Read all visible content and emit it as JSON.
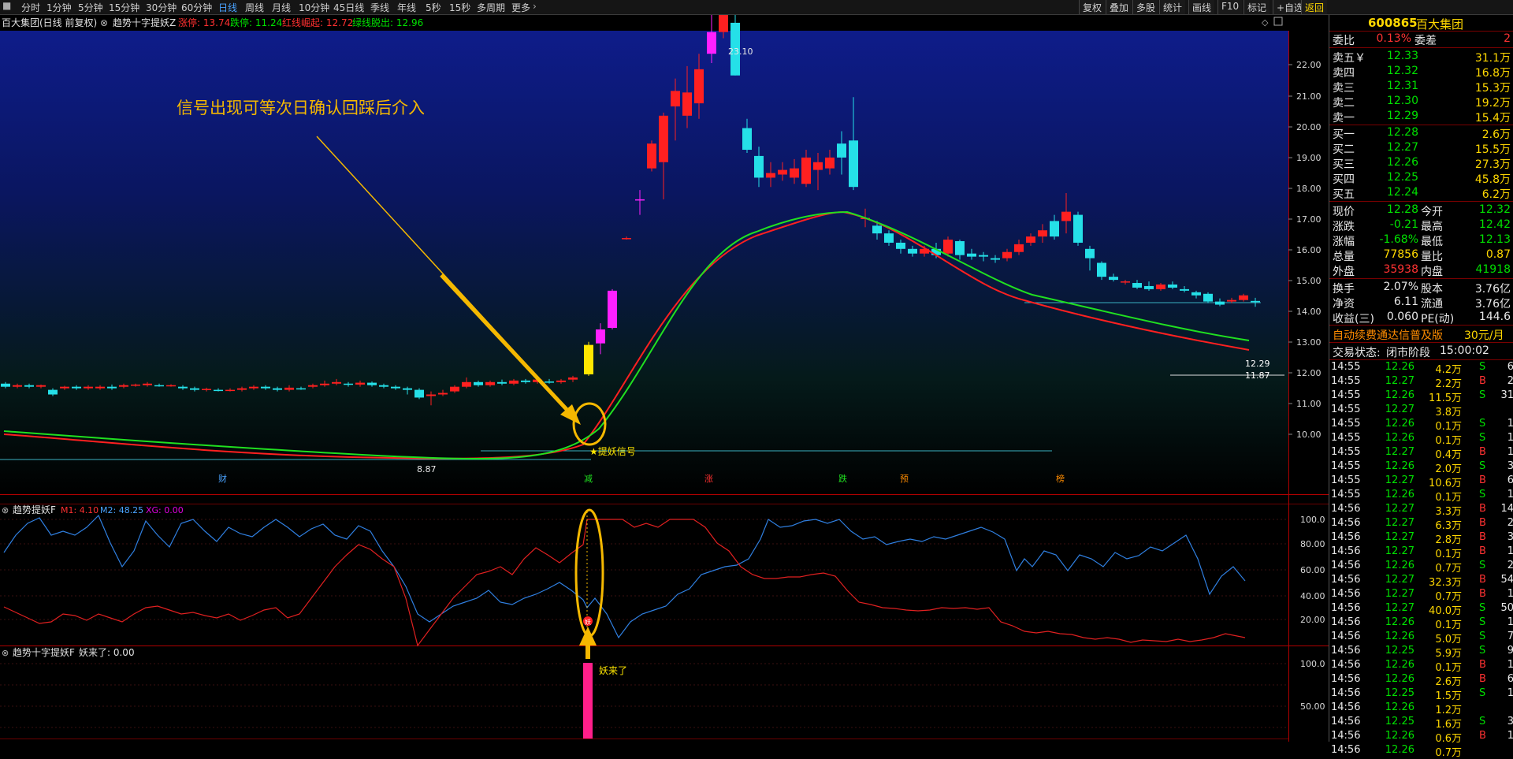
{
  "toolbar": {
    "periods": [
      "分时",
      "1分钟",
      "5分钟",
      "15分钟",
      "30分钟",
      "60分钟",
      "日线",
      "周线",
      "月线",
      "10分钟",
      "45日线",
      "季线",
      "年线",
      "5秒",
      "15秒",
      "多周期",
      "更多"
    ],
    "active_period": "日线",
    "right_buttons": [
      "复权",
      "叠加",
      "多股",
      "统计",
      "画线",
      "F10",
      "标记",
      "+自选",
      "返回"
    ]
  },
  "main_chart": {
    "stock_label": "百大集团(日线 前复权)",
    "indicator_name": "趋势十字提妖Z",
    "indicators": [
      {
        "label": "涨停: 13.74",
        "color": "#ff3030"
      },
      {
        "label": "跌停: 11.24",
        "color": "#00e000"
      },
      {
        "label": "红线崛起: 12.72",
        "color": "#ff3030"
      },
      {
        "label": "绿线脱出: 12.96",
        "color": "#00e000"
      }
    ],
    "annotation_text": "信号出现可等次日确认回踩后介入",
    "signal_label": "★提妖信号",
    "high_label": "23.10",
    "low_label": "8.87",
    "price_label_1": "12.29",
    "price_label_2": "11.87",
    "event_markers": [
      "财",
      "减",
      "涨",
      "跌",
      "预",
      "榜"
    ],
    "y_ticks": [
      "22.00",
      "21.00",
      "20.00",
      "19.00",
      "18.00",
      "17.00",
      "16.00",
      "15.00",
      "14.00",
      "13.00",
      "12.00",
      "11.00",
      "10.00"
    ]
  },
  "sub_chart_1": {
    "title": "趋势提妖F",
    "m1_label": "M1: 4.10",
    "m2_label": "M2: 48.25",
    "xg_label": "XG: 0.00",
    "y_ticks": [
      "100.0",
      "80.00",
      "60.00",
      "40.00",
      "20.00"
    ]
  },
  "sub_chart_2": {
    "title": "趋势十字提妖F",
    "value_label": "妖来了: 0.00",
    "annotation": "妖来了",
    "y_ticks": [
      "100.0",
      "50.00"
    ]
  },
  "quote": {
    "code": "600865",
    "name": "百大集团",
    "weibi_label": "委比",
    "weibi": "0.13%",
    "weicha_label": "委差",
    "weicha": "2",
    "asks": [
      {
        "label": "卖五￥",
        "price": "12.33",
        "vol": "31.1万"
      },
      {
        "label": "卖四",
        "price": "12.32",
        "vol": "16.8万"
      },
      {
        "label": "卖三",
        "price": "12.31",
        "vol": "15.3万"
      },
      {
        "label": "卖二",
        "price": "12.30",
        "vol": "19.2万"
      },
      {
        "label": "卖一",
        "price": "12.29",
        "vol": "15.4万"
      }
    ],
    "bids": [
      {
        "label": "买一",
        "price": "12.28",
        "vol": "2.6万"
      },
      {
        "label": "买二",
        "price": "12.27",
        "vol": "15.5万"
      },
      {
        "label": "买三",
        "price": "12.26",
        "vol": "27.3万"
      },
      {
        "label": "买四",
        "price": "12.25",
        "vol": "45.8万"
      },
      {
        "label": "买五",
        "price": "12.24",
        "vol": "6.2万"
      }
    ],
    "stats": [
      {
        "l1": "现价",
        "v1": "12.28",
        "c1": "#00e000",
        "l2": "今开",
        "v2": "12.32",
        "c2": "#00e000"
      },
      {
        "l1": "涨跌",
        "v1": "-0.21",
        "c1": "#00e000",
        "l2": "最高",
        "v2": "12.42",
        "c2": "#00e000"
      },
      {
        "l1": "涨幅",
        "v1": "-1.68%",
        "c1": "#00e000",
        "l2": "最低",
        "v2": "12.13",
        "c2": "#00e000"
      },
      {
        "l1": "总量",
        "v1": "77856",
        "c1": "#ffd800",
        "l2": "量比",
        "v2": "0.87",
        "c2": "#ffd800"
      },
      {
        "l1": "外盘",
        "v1": "35938",
        "c1": "#ff3232",
        "l2": "内盘",
        "v2": "41918",
        "c2": "#00e000"
      }
    ],
    "stats2": [
      {
        "l1": "换手",
        "v1": "2.07%",
        "l2": "股本",
        "v2": "3.76亿"
      },
      {
        "l1": "净资",
        "v1": "6.11",
        "l2": "流通",
        "v2": "3.76亿"
      },
      {
        "l1": "收益(三)",
        "v1": "0.060",
        "l2": "PE(动)",
        "v2": "144.6"
      }
    ],
    "promo": "自动续费通达信普及版",
    "promo_price": "30元/月",
    "status_label": "交易状态:",
    "status_value": "闭市阶段",
    "status_time": "15:00:02",
    "ticks": [
      [
        "14:55",
        "12.26",
        "4.2万",
        "S",
        "6"
      ],
      [
        "14:55",
        "12.27",
        "2.2万",
        "B",
        "2"
      ],
      [
        "14:55",
        "12.26",
        "11.5万",
        "S",
        "31"
      ],
      [
        "14:55",
        "12.27",
        "3.8万",
        "",
        ""
      ],
      [
        "14:55",
        "12.26",
        "0.1万",
        "S",
        "1"
      ],
      [
        "14:55",
        "12.26",
        "0.1万",
        "S",
        "1"
      ],
      [
        "14:55",
        "12.27",
        "0.4万",
        "B",
        "1"
      ],
      [
        "14:55",
        "12.26",
        "2.0万",
        "S",
        "3"
      ],
      [
        "14:55",
        "12.27",
        "10.6万",
        "B",
        "6"
      ],
      [
        "14:55",
        "12.26",
        "0.1万",
        "S",
        "1"
      ],
      [
        "14:56",
        "12.27",
        "3.3万",
        "B",
        "14"
      ],
      [
        "14:56",
        "12.27",
        "6.3万",
        "B",
        "2"
      ],
      [
        "14:56",
        "12.27",
        "2.8万",
        "B",
        "3"
      ],
      [
        "14:56",
        "12.27",
        "0.1万",
        "B",
        "1"
      ],
      [
        "14:56",
        "12.26",
        "0.7万",
        "S",
        "2"
      ],
      [
        "14:56",
        "12.27",
        "32.3万",
        "B",
        "54"
      ],
      [
        "14:56",
        "12.27",
        "0.7万",
        "B",
        "1"
      ],
      [
        "14:56",
        "12.27",
        "40.0万",
        "S",
        "50"
      ],
      [
        "14:56",
        "12.26",
        "0.1万",
        "S",
        "1"
      ],
      [
        "14:56",
        "12.26",
        "5.0万",
        "S",
        "7"
      ],
      [
        "14:56",
        "12.25",
        "5.9万",
        "S",
        "9"
      ],
      [
        "14:56",
        "12.26",
        "0.1万",
        "B",
        "1"
      ],
      [
        "14:56",
        "12.26",
        "2.6万",
        "B",
        "6"
      ],
      [
        "14:56",
        "12.25",
        "1.5万",
        "S",
        "1"
      ],
      [
        "14:56",
        "12.26",
        "1.2万",
        "",
        ""
      ],
      [
        "14:56",
        "12.25",
        "1.6万",
        "S",
        "3"
      ],
      [
        "14:56",
        "12.26",
        "0.6万",
        "B",
        "1"
      ],
      [
        "14:56",
        "12.26",
        "0.7万",
        "",
        ""
      ]
    ]
  }
}
